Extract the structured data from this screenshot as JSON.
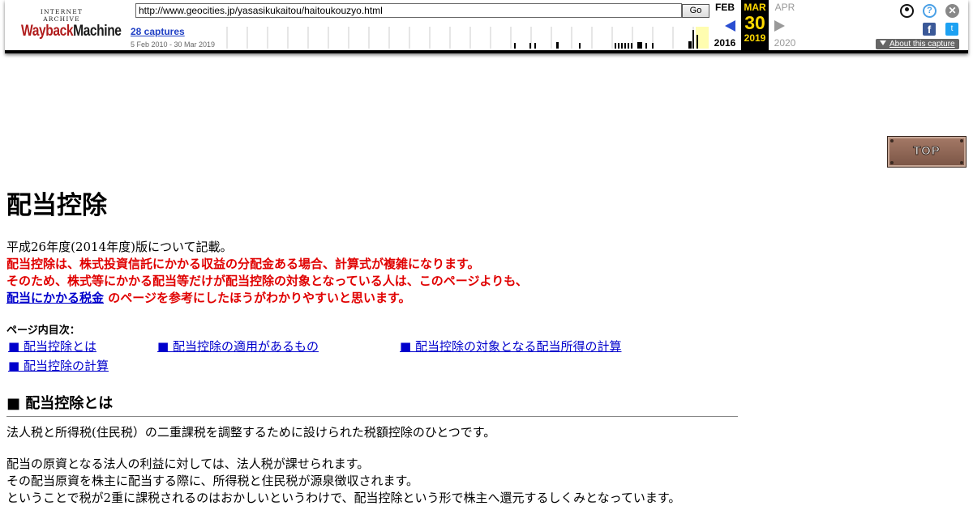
{
  "wayback": {
    "logo_top": "INTERNET ARCHIVE",
    "logo_main_a": "Wayback",
    "logo_main_b": "Machine",
    "url": "http://www.geocities.jp/yasasikukaitou/haitoukouzyo.html",
    "go_label": "Go",
    "captures": "28 captures",
    "range": "5 Feb 2010 - 30 Mar 2019",
    "prev_month": "FEB",
    "prev_year": "2016",
    "cur_month": "MAR",
    "cur_day": "30",
    "cur_year": "2019",
    "next_month": "APR",
    "next_year": "2020",
    "about": "About this capture",
    "facebook_glyph": "f",
    "twitter_glyph": "t",
    "help_glyph": "?",
    "close_glyph": "✕"
  },
  "top_button": "TOP",
  "page": {
    "title": "配当控除",
    "intro_line1": "平成26年度(2014年度)版について記載。",
    "intro_line2": "配当控除は、株式投資信託にかかる収益の分配金ある場合、計算式が複雑になります。",
    "intro_line3": "そのため、株式等にかかる配当等だけが配当控除の対象となっている人は、このページよりも、",
    "intro_link": "配当にかかる税金",
    "intro_line4_rest": " のページを参考にしたほうがわかりやすいと思います。",
    "toc_title": "ページ内目次：",
    "toc": [
      "■ 配当控除とは",
      "■ 配当控除の適用があるもの",
      "■ 配当控除の対象となる配当所得の計算",
      "■ 配当控除の計算"
    ],
    "section_heading": "■ 配当控除とは",
    "para1": "法人税と所得税(住民税）の二重課税を調整するために設けられた税額控除のひとつです。",
    "para2": "配当の原資となる法人の利益に対しては、法人税が課せられます。",
    "para3": "その配当原資を株主に配当する際に、所得税と住民税が源泉徴収されます。",
    "para4": "ということで税が2重に課税されるのはおかしいというわけで、配当控除という形で株主へ還元するしくみとなっています。"
  }
}
